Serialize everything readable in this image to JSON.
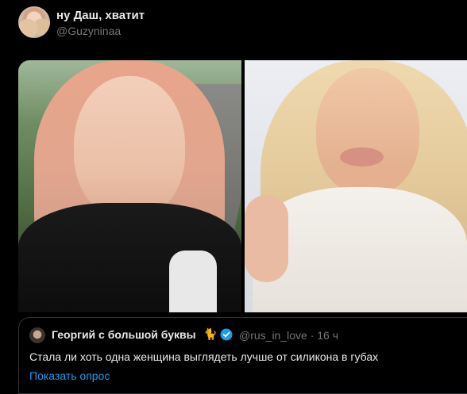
{
  "tweet": {
    "display_name": "ну Даш, хватит",
    "handle": "@Guzyninaa"
  },
  "media": {
    "images": [
      {
        "icon": "photo-left"
      },
      {
        "icon": "photo-right"
      }
    ]
  },
  "quoted_tweet": {
    "display_name": "Георгий с большой буквы",
    "emoji": "🐈",
    "verified_icon": "verified-badge-icon",
    "handle_time": "@rus_in_love · 16 ч",
    "text": "Стала ли хоть одна женщина выглядеть лучше от силикона в губах",
    "link_label": "Показать опрос"
  },
  "colors": {
    "background": "#000000",
    "text_primary": "#e7e9ea",
    "text_secondary": "#71767b",
    "link": "#1d9bf0",
    "border": "#2f3336"
  }
}
